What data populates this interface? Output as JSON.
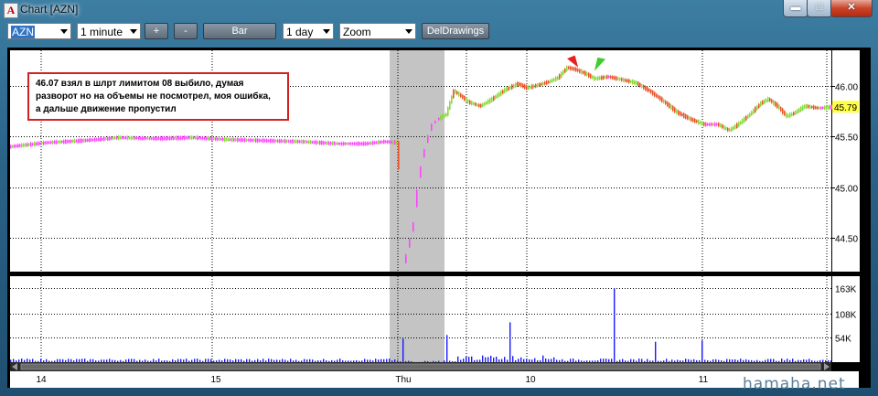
{
  "window": {
    "title": "Chart [AZN]",
    "icon_letter": "A"
  },
  "toolbar": {
    "symbol": "AZN",
    "interval": "1 minute",
    "plus_label": "+",
    "minus_label": "-",
    "bar_label": "Bar",
    "range": "1 day",
    "zoom": "Zoom",
    "deldrawings_label": "DelDrawings"
  },
  "annotation": {
    "lines": [
      "46.07 взял в шлрт лимитом 08 выбило, думая",
      "разворот но на объемы не посмотрел, моя ошибка,",
      "а дальше движение пропустил"
    ]
  },
  "watermark": "hamaha.net",
  "colors": {
    "up": "#88d83a",
    "down": "#e8542a",
    "flat": "#ff44ff",
    "volume": "#1a1aff",
    "current": "#ffff44",
    "highlight": "#c4c4c4"
  },
  "chart_data": [
    {
      "type": "candlestick",
      "name": "AZN 1 minute",
      "y_ticks": [
        44.5,
        45.0,
        45.5,
        46.0
      ],
      "y_tick_labels": [
        "44.50",
        "45.00",
        "45.50",
        "46.00"
      ],
      "ylim": [
        44.17,
        46.35
      ],
      "current_price": 45.79,
      "current_label": "45.79",
      "x_tick_labels": [
        "14",
        "15",
        "Thu",
        "10",
        "11"
      ],
      "price_path": [
        [
          0,
          45.4
        ],
        [
          40,
          45.44
        ],
        [
          80,
          45.46
        ],
        [
          120,
          45.49
        ],
        [
          160,
          45.48
        ],
        [
          200,
          45.49
        ],
        [
          240,
          45.47
        ],
        [
          280,
          45.46
        ],
        [
          320,
          45.45
        ],
        [
          360,
          45.43
        ],
        [
          390,
          45.43
        ],
        [
          410,
          45.45
        ],
        [
          425,
          45.44
        ],
        [
          430,
          44.18
        ],
        [
          437,
          44.45
        ],
        [
          442,
          44.65
        ],
        [
          447,
          45.05
        ],
        [
          452,
          45.3
        ],
        [
          457,
          45.48
        ],
        [
          462,
          45.62
        ],
        [
          470,
          45.68
        ],
        [
          478,
          45.72
        ],
        [
          486,
          45.95
        ],
        [
          494,
          45.9
        ],
        [
          502,
          45.84
        ],
        [
          515,
          45.8
        ],
        [
          528,
          45.87
        ],
        [
          542,
          45.96
        ],
        [
          556,
          46.02
        ],
        [
          566,
          45.98
        ],
        [
          575,
          46.0
        ],
        [
          590,
          46.04
        ],
        [
          600,
          46.08
        ],
        [
          610,
          46.18
        ],
        [
          620,
          46.16
        ],
        [
          630,
          46.12
        ],
        [
          640,
          46.07
        ],
        [
          655,
          46.09
        ],
        [
          670,
          46.06
        ],
        [
          685,
          46.03
        ],
        [
          700,
          45.95
        ],
        [
          715,
          45.85
        ],
        [
          730,
          45.74
        ],
        [
          745,
          45.67
        ],
        [
          760,
          45.62
        ],
        [
          775,
          45.62
        ],
        [
          787,
          45.56
        ],
        [
          797,
          45.62
        ],
        [
          810,
          45.72
        ],
        [
          822,
          45.83
        ],
        [
          830,
          45.87
        ],
        [
          840,
          45.8
        ],
        [
          850,
          45.7
        ],
        [
          858,
          45.73
        ],
        [
          870,
          45.8
        ],
        [
          885,
          45.78
        ],
        [
          898,
          45.79
        ]
      ],
      "volume_ticks": [
        54000,
        108000,
        163000
      ],
      "volume_tick_labels": [
        "54K",
        "108K",
        "163K"
      ],
      "volume_ylim": [
        0,
        190000
      ],
      "volume_spikes": [
        [
          430,
          52000
        ],
        [
          476,
          60000
        ],
        [
          545,
          88000
        ],
        [
          660,
          163000
        ],
        [
          706,
          45000
        ],
        [
          757,
          48000
        ]
      ],
      "annotations": [
        {
          "kind": "sell-arrow",
          "x": 620,
          "y": 46.18
        },
        {
          "kind": "buy-arrow",
          "x": 640,
          "y": 46.14
        }
      ]
    }
  ]
}
